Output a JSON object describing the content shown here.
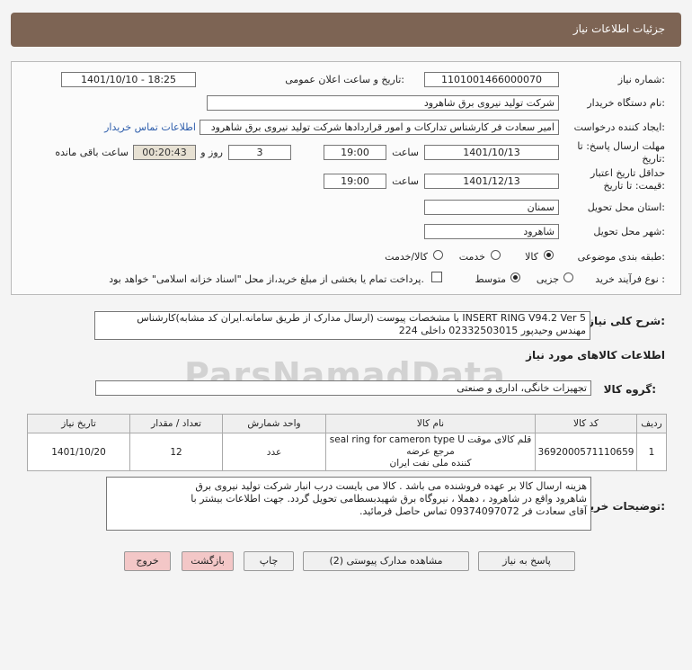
{
  "header": {
    "title": "جزئیات اطلاعات نیاز"
  },
  "form": {
    "need_number": {
      "label": "شماره نیاز:",
      "value": "1101001466000070"
    },
    "announce_datetime": {
      "label": "تاریخ و ساعت اعلان عمومی:",
      "value": "1401/10/10 - 18:25"
    },
    "buyer_org": {
      "label": "نام دستگاه خریدار:",
      "value": "شرکت تولید نیروی برق شاهرود"
    },
    "requester": {
      "label": "ایجاد کننده درخواست:",
      "value": "امیر سعادت فر کارشناس تدارکات و امور قراردادها شرکت تولید نیروی برق شاهرود",
      "contact_link": "اطلاعات تماس خریدار"
    },
    "response_deadline": {
      "label": "مهلت ارسال پاسخ: تا تاریخ:",
      "date": "1401/10/13",
      "time_label": "ساعت",
      "time": "19:00",
      "days": "3",
      "days_label": "روز و",
      "remaining": "00:20:43",
      "remaining_label": "ساعت باقی مانده"
    },
    "price_validity": {
      "label": "حداقل تاریخ اعتبار قیمت: تا تاریخ:",
      "date": "1401/12/13",
      "time_label": "ساعت",
      "time": "19:00"
    },
    "delivery_province": {
      "label": "استان محل تحویل:",
      "value": "سمنان"
    },
    "delivery_city": {
      "label": "شهر محل تحویل:",
      "value": "شاهرود"
    },
    "category": {
      "label": "طبقه بندی موضوعی:",
      "options": [
        "کالا",
        "خدمت",
        "کالا/خدمت"
      ]
    },
    "purchase_type": {
      "label": "نوع فرآیند خرید :",
      "options": [
        "جزیی",
        "متوسط"
      ],
      "payment_note": "پرداخت تمام یا بخشی از مبلغ خرید،از محل \"اسناد خزانه اسلامی\" خواهد بود."
    }
  },
  "description": {
    "label": "شرح کلی نیاز:",
    "line1": "INSERT RING V94.2 Ver 5 با مشخصات پیوست (ارسال مدارک از طریق سامانه.ایران کد مشابه)کارشناس",
    "line2": "مهندس وحیدپور 02332503015 داخلی 224"
  },
  "goods_info": {
    "heading": "اطلاعات کالاهای مورد نیاز",
    "group_label": "گروه کالا:",
    "group_value": "تجهیزات خانگی، اداری و صنعتی",
    "columns": [
      "ردیف",
      "کد کالا",
      "نام کالا",
      "واحد شمارش",
      "تعداد / مقدار",
      "تاریخ نیاز"
    ],
    "rows": [
      {
        "row": "1",
        "code": "3692000571110659",
        "name_line1": "قلم کالای موقت seal ring for cameron type U مرجع عرضه",
        "name_line2": "کننده ملی نفت ایران",
        "unit": "عدد",
        "qty": "12",
        "date": "1401/10/20"
      }
    ]
  },
  "buyer_notes": {
    "label": "توضیحات خریدار:",
    "line1": "هزینه ارسال کالا بر عهده فروشنده می باشد . کالا می بایست درب انبار شرکت تولید نیروی برق",
    "line2": "شاهرود واقع در شاهرود ، دهملا ، نیروگاه برق شهیدبسطامی تحویل گردد. جهت اطلاعات بیشتر با",
    "line3": "آقای سعادت فر 09374097072 تماس حاصل فرمائید."
  },
  "buttons": {
    "reply": "پاسخ به نیاز",
    "attachments": "مشاهده مدارک پیوستی (2)",
    "print": "چاپ",
    "back": "بازگشت",
    "exit": "خروج"
  },
  "watermark": "ParsNamadData"
}
